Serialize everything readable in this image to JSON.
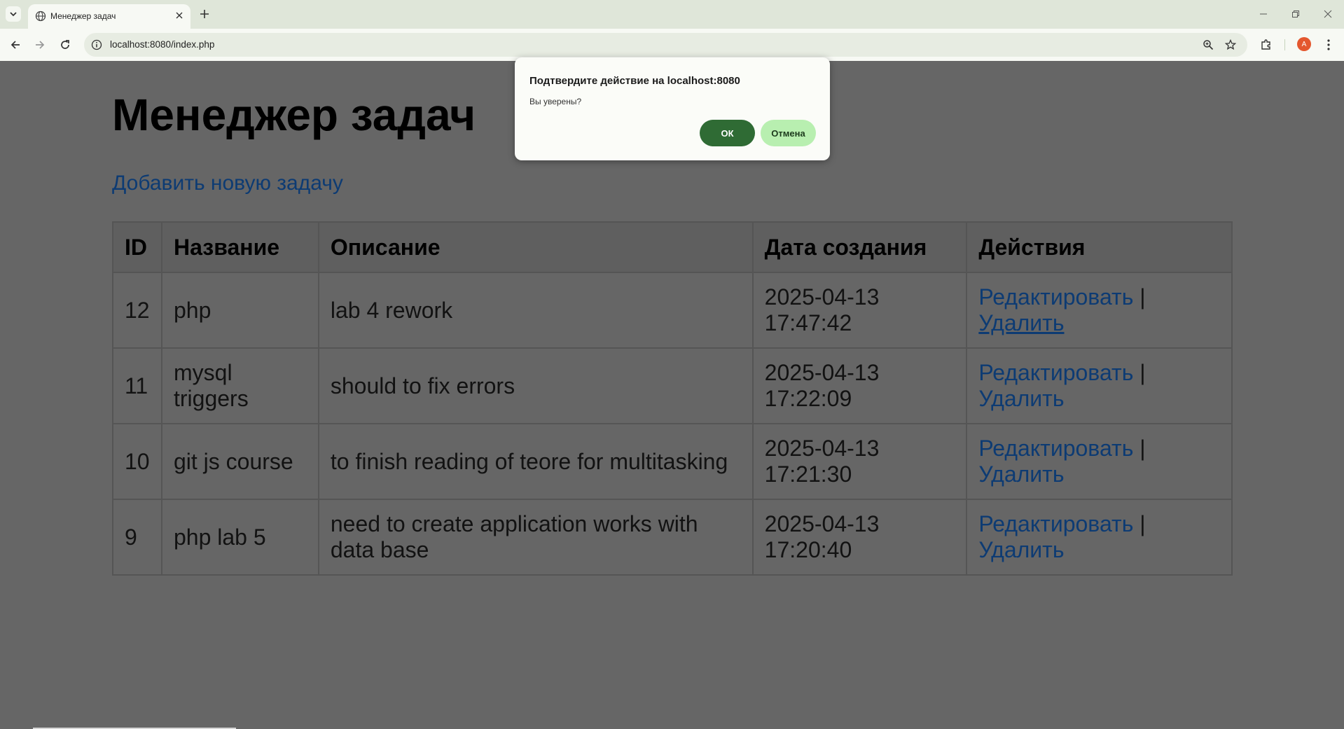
{
  "browser": {
    "tab_title": "Менеджер задач",
    "url": "localhost:8080/index.php",
    "avatar_letter": "A"
  },
  "page": {
    "title": "Менеджер задач",
    "add_link": "Добавить новую задачу",
    "table": {
      "headers": [
        "ID",
        "Название",
        "Описание",
        "Дата создания",
        "Действия"
      ],
      "rows": [
        {
          "id": "12",
          "name": "php",
          "description": "lab 4 rework",
          "date": "2025-04-13",
          "time": "17:47:42"
        },
        {
          "id": "11",
          "name": "mysql triggers",
          "description": "should to fix errors",
          "date": "2025-04-13",
          "time": "17:22:09"
        },
        {
          "id": "10",
          "name": "git js course",
          "description": "to finish reading of teore for multitasking",
          "date": "2025-04-13",
          "time": "17:21:30"
        },
        {
          "id": "9",
          "name": "php lab 5",
          "description": "need to create application works with data base",
          "date": "2025-04-13",
          "time": "17:20:40"
        }
      ],
      "edit_label": "Редактировать",
      "separator": " |",
      "delete_label": "Удалить"
    }
  },
  "dialog": {
    "title": "Подтвердите действие на localhost:8080",
    "message": "Вы уверены?",
    "ok_label": "ОК",
    "cancel_label": "Отмена"
  },
  "colors": {
    "ok_button": "#2f6b34",
    "cancel_button": "#b8efb0",
    "link": "#0d3b73",
    "overlay_bg": "#666666"
  }
}
